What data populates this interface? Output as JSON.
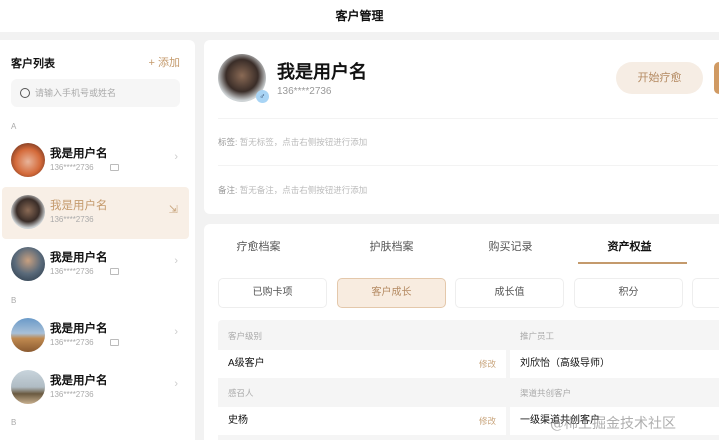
{
  "header": {
    "title": "客户管理"
  },
  "sidebar": {
    "title": "客户列表",
    "add_label": "+ 添加",
    "search_placeholder": "请输入手机号或姓名",
    "letters": [
      "A",
      "B",
      "B"
    ],
    "customers": [
      {
        "name": "我是用户名",
        "phone": "136****2736"
      },
      {
        "name": "我是用户名",
        "phone": "136****2736"
      },
      {
        "name": "我是用户名",
        "phone": "136****2736"
      },
      {
        "name": "我是用户名",
        "phone": "136****2736"
      },
      {
        "name": "我是用户名",
        "phone": "136****2736"
      }
    ]
  },
  "profile": {
    "name": "我是用户名",
    "phone": "136****2736",
    "gender_icon": "♂",
    "start_button": "开始疗愈",
    "tags_label": "标签:",
    "tags_value": "暂无标签，点击右侧按钮进行添加",
    "note_label": "备注:",
    "note_value": "暂无备注，点击右侧按钮进行添加"
  },
  "tabs": [
    "疗愈档案",
    "护肤档案",
    "购买记录",
    "资产权益"
  ],
  "subtabs": [
    "已购卡项",
    "客户成长",
    "成长值",
    "积分"
  ],
  "fields": [
    {
      "label": "客户级别",
      "value": "A级客户",
      "edit": "修改"
    },
    {
      "label": "推广员工",
      "value": "刘欣怡（高级导师）"
    },
    {
      "label": "感召人",
      "value": "史杨",
      "edit": "修改"
    },
    {
      "label": "渠道共创客户",
      "value": "一级渠道共创客户"
    }
  ],
  "watermark": "@稀土掘金技术社区"
}
